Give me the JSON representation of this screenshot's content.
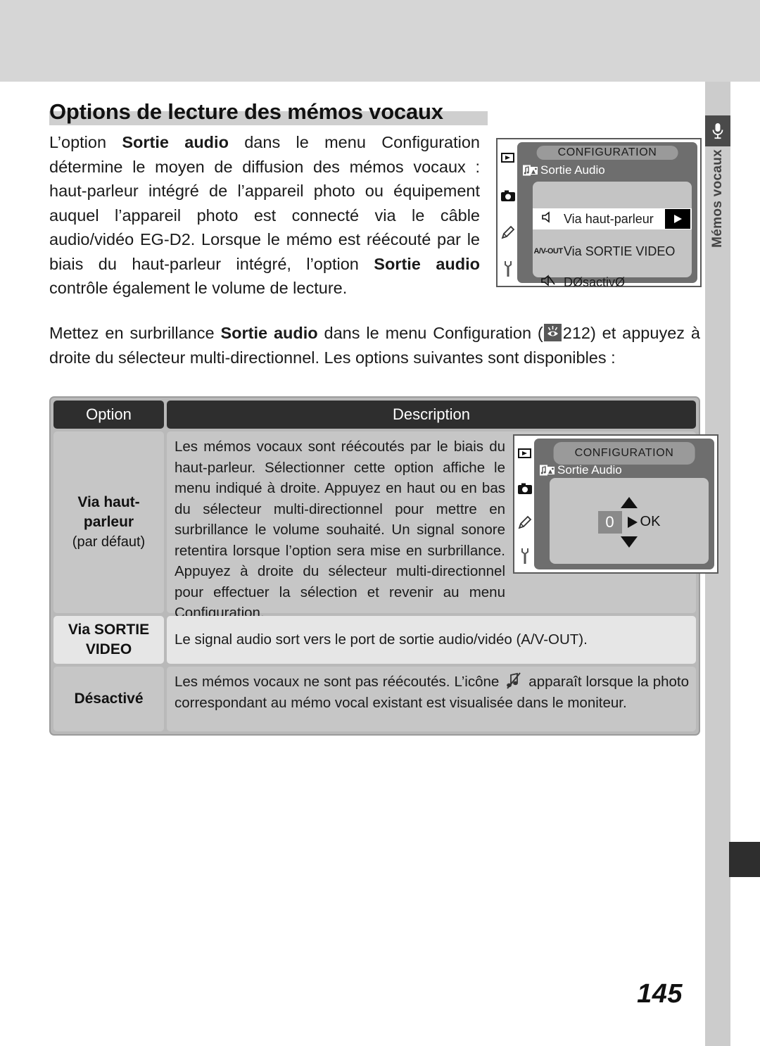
{
  "page": {
    "number": "145",
    "heading": "Options de lecture des mémos vocaux"
  },
  "side_tab": {
    "icon": "microphone-icon",
    "label": "Mémos vocaux"
  },
  "intro": {
    "part1": "L’option ",
    "bold1": "Sortie audio",
    "part2": " dans le menu Configuration détermine le moyen de diffusion des mémos vocaux : haut-parleur intégré de l’appareil photo ou équipement auquel l’appareil photo est connecté via le câble audio/vidéo EG-D2. Lorsque le mémo est réécouté par le biais du haut-parleur intégré, l’option ",
    "bold2": "Sortie audio",
    "part3": " contrôle également le volume de lecture."
  },
  "para2": {
    "part1": "Mettez en surbrillance ",
    "bold1": "Sortie audio",
    "part2": " dans le menu Configuration (",
    "ref_icon": "eye-page-reference-icon",
    "ref_page": "212",
    "part3": ") et appuyez à droite du sélecteur multi-directionnel. Les options suivantes sont disponibles :"
  },
  "lcd_top": {
    "title": "CONFIGURATION",
    "subtitle": "Sortie Audio",
    "tabs": [
      "playback-tab-icon",
      "shooting-tab-icon",
      "custom-tab-icon",
      "setup-tab-icon"
    ],
    "items": [
      {
        "icon": "speaker-icon",
        "label": "Via haut-parleur",
        "selected": true,
        "arrow": "▶"
      },
      {
        "icon": "av-out-icon",
        "icon_text": "A/V-OUT",
        "label": "Via SORTIE VIDEO",
        "selected": false
      },
      {
        "icon": "speaker-muted-icon",
        "label": "DØsactivØ",
        "selected": false
      }
    ]
  },
  "lcd_table": {
    "title": "CONFIGURATION",
    "subtitle": "Sortie Audio",
    "up_arrow": "▲",
    "down_arrow": "▼",
    "value": "0",
    "ok_arrow": "▶",
    "ok_label": "OK"
  },
  "table": {
    "headers": {
      "option": "Option",
      "description": "Description"
    },
    "rows": [
      {
        "option_main": "Via haut-\nparleur",
        "option_line1": "Via haut-",
        "option_line2": "parleur",
        "option_sub": "(par défaut)",
        "description": "Les mémos vocaux sont réécoutés par le biais du haut-parleur. Sélectionner cette option affiche le menu indiqué à droite. Appuyez en haut ou en bas du sélecteur multi-directionnel pour mettre en surbrillance le volume souhaité. Un signal sonore retentira lorsque l’option sera mise en surbrillance. Appuyez à droite du sélecteur multi-directionnel pour effectuer la sélection et revenir au menu Configuration."
      },
      {
        "option_line1": "Via SORTIE",
        "option_line2": "VIDEO",
        "description": "Le signal audio sort vers le port de sortie audio/vidéo (A/V-OUT)."
      },
      {
        "option_line1": "Désactivé",
        "desc_part1": "Les mémos vocaux ne sont pas réécoutés. L’icône ",
        "desc_icon": "muted-note-icon",
        "desc_part2": " apparaît lorsque la photo correspondant au mémo vocal existant est visualisée dans le moniteur."
      }
    ]
  },
  "colors": {
    "band": "#d6d6d6",
    "strip": "#cccccc",
    "header_dark": "#2e2e2e",
    "row_shade_a": "#c6c6c6",
    "row_shade_b": "#e6e6e6",
    "lcd_body": "#6e6e6e",
    "lcd_panel": "#c4c4c4"
  }
}
